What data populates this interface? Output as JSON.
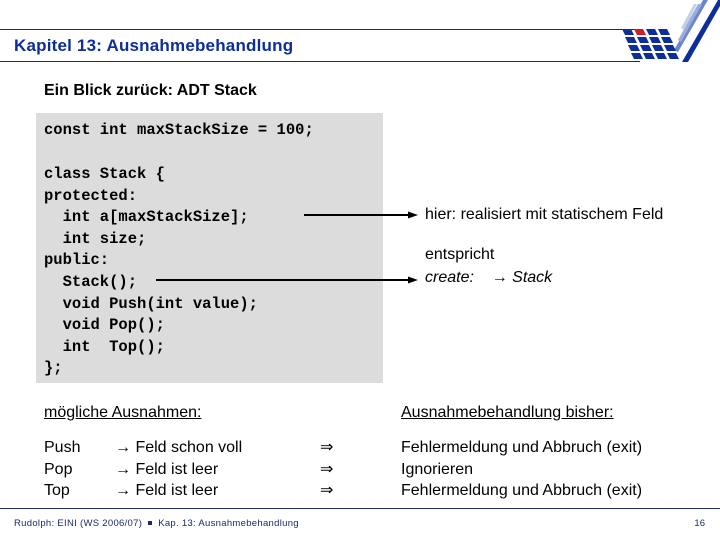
{
  "header": {
    "title": "Kapitel 13: Ausnahmebehandlung",
    "logo": "university-logo-icon",
    "brand_color": "#0d2d9a",
    "logo_accent_color": "#cc1f2a"
  },
  "section": {
    "subtitle": "Ein Blick zurück: ADT Stack"
  },
  "code": {
    "lines": [
      "const int maxStackSize = 100;",
      "",
      "class Stack {",
      "protected:",
      "  int a[maxStackSize];",
      "  int size;",
      "public:",
      "  Stack();",
      "  void Push(int value);",
      "  void Pop();",
      "  int  Top();",
      "};"
    ]
  },
  "annotations": {
    "array_note": "hier: realisiert mit statischem Feld",
    "ctor_note_line1": "entspricht",
    "ctor_note_create": "create:",
    "ctor_note_result": "→ Stack"
  },
  "exceptions": {
    "left_heading": "mögliche Ausnahmen:",
    "right_heading": "Ausnahmebehandlung bisher:",
    "implies_symbol": "⇒",
    "rows": [
      {
        "op": "Push",
        "cause": "→ Feld schon voll",
        "handling": "Fehlermeldung und Abbruch (exit)"
      },
      {
        "op": "Pop",
        "cause": "→ Feld ist leer",
        "handling": "Ignorieren"
      },
      {
        "op": "Top",
        "cause": "→ Feld ist leer",
        "handling": "Fehlermeldung und Abbruch (exit)"
      }
    ]
  },
  "footer": {
    "left_part1": "Rudolph: EINI (WS 2006/07)",
    "left_part2": "Kap. 13: Ausnahmebehandlung",
    "page_number": "16"
  }
}
